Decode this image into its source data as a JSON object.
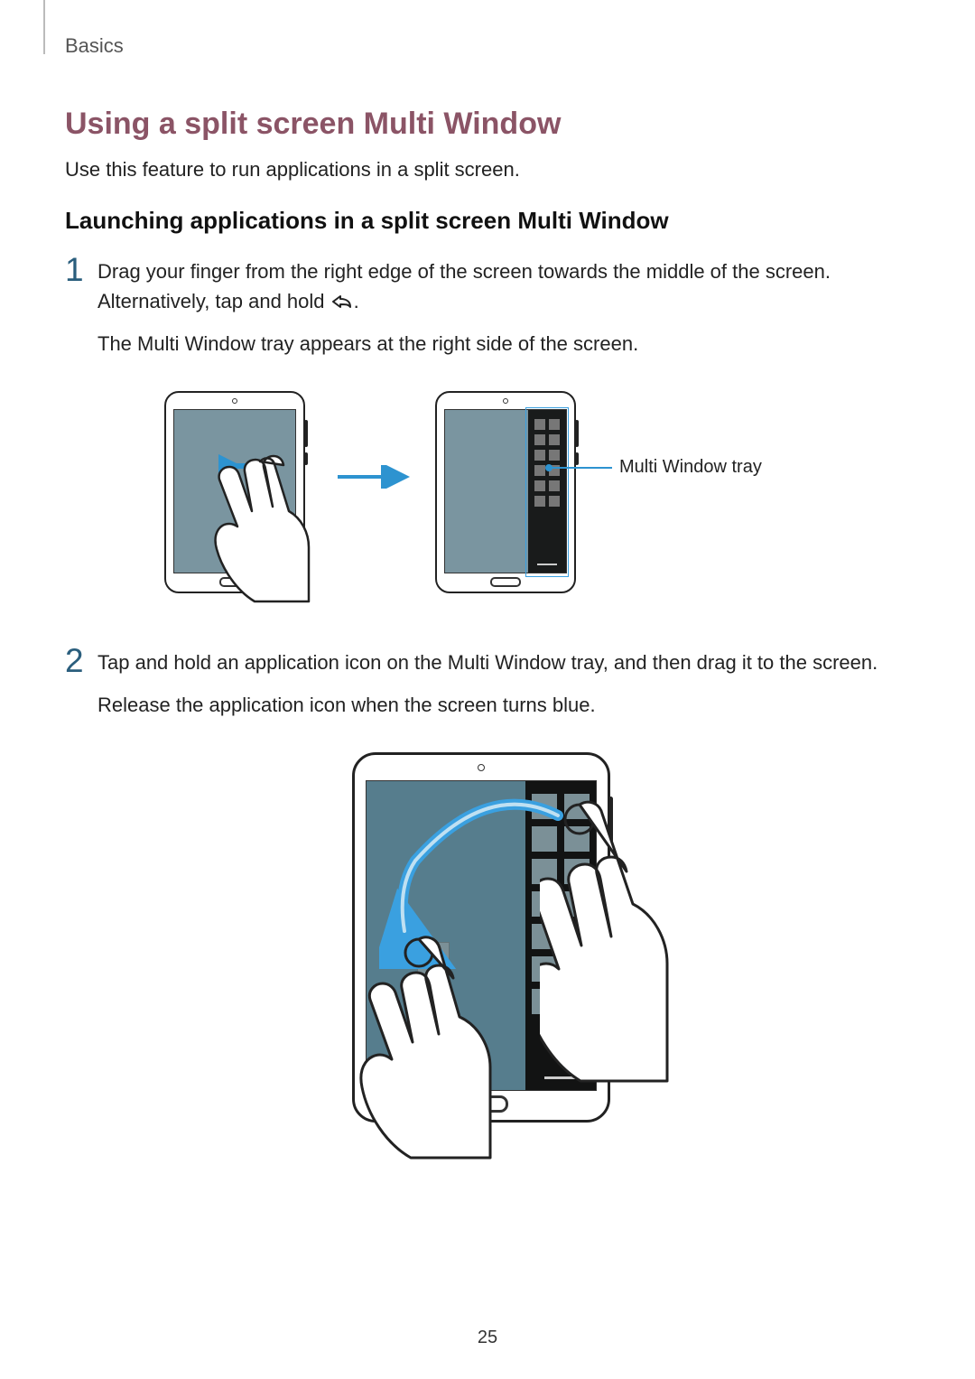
{
  "header": {
    "chapter": "Basics"
  },
  "page": {
    "number": "25"
  },
  "section": {
    "title": "Using a split screen Multi Window",
    "intro": "Use this feature to run applications in a split screen.",
    "subheading": "Launching applications in a split screen Multi Window"
  },
  "steps": {
    "s1": {
      "num": "1",
      "line1a": "Drag your finger from the right edge of the screen towards the middle of the screen. Alternatively, tap and hold ",
      "line1b": ".",
      "line2": "The Multi Window tray appears at the right side of the screen."
    },
    "s2": {
      "num": "2",
      "line1": "Tap and hold an application icon on the Multi Window tray, and then drag it to the screen.",
      "line2": "Release the application icon when the screen turns blue."
    }
  },
  "callouts": {
    "tray": "Multi Window tray"
  },
  "icons": {
    "back": "back-icon"
  }
}
